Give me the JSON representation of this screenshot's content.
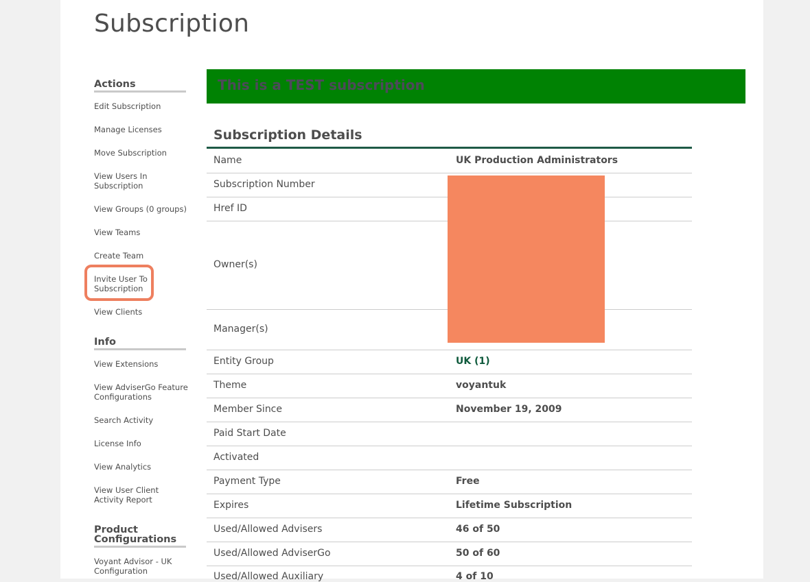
{
  "page": {
    "title": "Subscription"
  },
  "sidebar": {
    "actions_heading": "Actions",
    "actions": [
      "Edit Subscription",
      "Manage Licenses",
      "Move Subscription",
      "View Users In Subscription",
      "View Groups (0 groups)",
      "View Teams",
      "Create Team",
      "Invite User To Subscription",
      "View Clients"
    ],
    "info_heading": "Info",
    "info": [
      "View Extensions",
      "View AdviserGo Feature Configurations",
      "Search Activity",
      "License Info",
      "View Analytics",
      "View User Client Activity Report"
    ],
    "product_heading": "Product Configurations",
    "product": [
      "Voyant Advisor - UK Configuration"
    ]
  },
  "banner": {
    "text": "This is a TEST subscription",
    "color": "#008203"
  },
  "details": {
    "title": "Subscription Details",
    "rows": [
      {
        "label": "Name",
        "value": "UK Production Administrators"
      },
      {
        "label": "Subscription Number",
        "value": ""
      },
      {
        "label": "Href ID",
        "value": ""
      },
      {
        "label": "Owner(s)",
        "value": ""
      },
      {
        "label": "Manager(s)",
        "value": ""
      },
      {
        "label": "Entity Group",
        "value": "UK (1)"
      },
      {
        "label": "Theme",
        "value": "voyantuk"
      },
      {
        "label": "Member Since",
        "value": "November 19, 2009"
      },
      {
        "label": "Paid Start Date",
        "value": ""
      },
      {
        "label": "Activated",
        "value": ""
      },
      {
        "label": "Payment Type",
        "value": "Free"
      },
      {
        "label": "Expires",
        "value": "Lifetime Subscription"
      },
      {
        "label": "Used/Allowed Advisers",
        "value": "46 of 50"
      },
      {
        "label": "Used/Allowed AdviserGo",
        "value": "50 of 60"
      },
      {
        "label": "Used/Allowed Auxiliary",
        "value": "4 of 10"
      }
    ]
  },
  "colors": {
    "accent_rule": "#1e5a46",
    "redaction": "#f5875f",
    "highlight": "#ee7f5f"
  }
}
